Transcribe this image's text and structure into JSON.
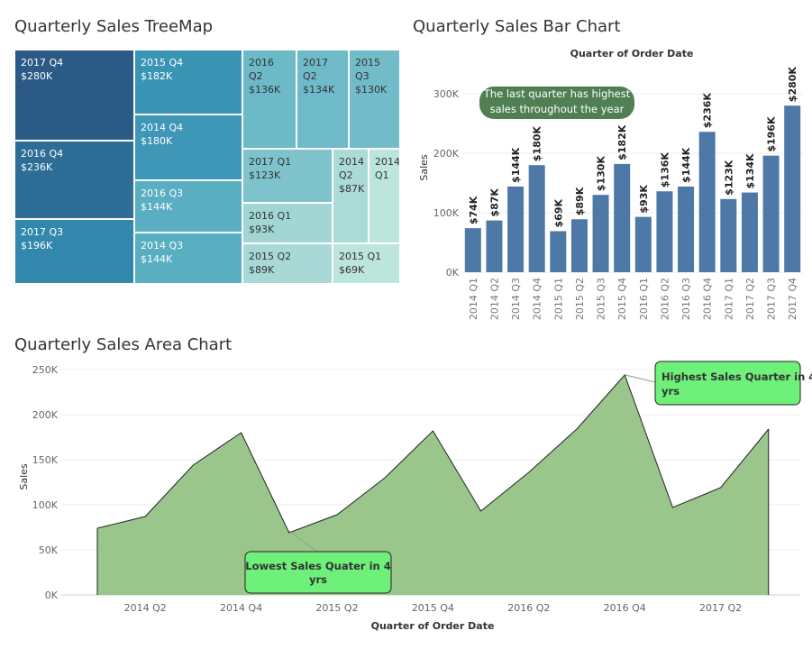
{
  "titles": {
    "treemap": "Quarterly Sales TreeMap",
    "bar": "Quarterly Sales Bar Chart",
    "area": "Quarterly Sales Area Chart"
  },
  "treemap_cells": [
    {
      "label": "2017 Q4",
      "value_label": "$280K",
      "color": "#2b5a87"
    },
    {
      "label": "2016 Q4",
      "value_label": "$236K",
      "color": "#2e6d95"
    },
    {
      "label": "2017 Q3",
      "value_label": "$196K",
      "color": "#3188ac"
    },
    {
      "label": "2015 Q4",
      "value_label": "$182K",
      "color": "#3a95b5"
    },
    {
      "label": "2014 Q4",
      "value_label": "$180K",
      "color": "#3e97b6"
    },
    {
      "label": "2016 Q3",
      "value_label": "$144K",
      "color": "#5aaec2"
    },
    {
      "label": "2014 Q3",
      "value_label": "$144K",
      "color": "#5aaec2"
    },
    {
      "label": "2016 Q2",
      "value_label": "$136K",
      "color": "#6cb9c7"
    },
    {
      "label": "2017 Q2",
      "value_label": "$134K",
      "color": "#6fbac8"
    },
    {
      "label": "2015 Q3",
      "value_label": "$130K",
      "color": "#72bcc9"
    },
    {
      "label": "2017 Q1",
      "value_label": "$123K",
      "color": "#7ec3cc"
    },
    {
      "label": "2016 Q1",
      "value_label": "$93K",
      "color": "#a2d6d4"
    },
    {
      "label": "2015 Q2",
      "value_label": "$89K",
      "color": "#a8d9d6"
    },
    {
      "label": "2014 Q2",
      "value_label": "$87K",
      "color": "#abdbd7"
    },
    {
      "label": "2015 Q1",
      "value_label": "$69K",
      "color": "#bce5dc"
    },
    {
      "label": "2014 Q1",
      "value_label": "",
      "color": "#bce5dc"
    }
  ],
  "bar_chart": {
    "header": "Quarter of Order Date",
    "ylabel": "Sales",
    "y_ticks": [
      "0K",
      "100K",
      "200K",
      "300K"
    ],
    "annotation": [
      "The last quarter has highest",
      "sales throughout the year"
    ]
  },
  "area_chart": {
    "xlabel": "Quarter of Order Date",
    "ylabel": "Sales",
    "y_ticks": [
      "0K",
      "50K",
      "100K",
      "150K",
      "200K",
      "250K"
    ],
    "x_ticks": [
      "2014 Q2",
      "2014 Q4",
      "2015 Q2",
      "2015 Q4",
      "2016 Q2",
      "2016 Q4",
      "2017 Q2"
    ],
    "annotation_low": [
      "Lowest Sales Quater in 4",
      "yrs"
    ],
    "annotation_high": [
      "Highest Sales Quarter in 4",
      "yrs"
    ]
  },
  "colors": {
    "bar": "#4e79a7",
    "area_fill": "#9ac68b",
    "area_line": "#222222",
    "callout_bar": "#4f7f52",
    "callout_area": "#6ef07a"
  },
  "chart_data": [
    {
      "type": "bar",
      "title": "Quarterly Sales Bar Chart",
      "xlabel": "Quarter of Order Date",
      "ylabel": "Sales",
      "categories": [
        "2014 Q1",
        "2014 Q2",
        "2014 Q3",
        "2014 Q4",
        "2015 Q1",
        "2015 Q2",
        "2015 Q3",
        "2015 Q4",
        "2016 Q1",
        "2016 Q2",
        "2016 Q3",
        "2016 Q4",
        "2017 Q1",
        "2017 Q2",
        "2017 Q3",
        "2017 Q4"
      ],
      "values": [
        74000,
        87000,
        144000,
        180000,
        69000,
        89000,
        130000,
        182000,
        93000,
        136000,
        144000,
        236000,
        123000,
        134000,
        196000,
        280000
      ],
      "data_labels": [
        "$74K",
        "$87K",
        "$144K",
        "$180K",
        "$69K",
        "$89K",
        "$130K",
        "$182K",
        "$93K",
        "$136K",
        "$144K",
        "$236K",
        "$123K",
        "$134K",
        "$196K",
        "$280K"
      ],
      "ylim": [
        0,
        300000
      ],
      "grid": true
    },
    {
      "type": "area",
      "title": "Quarterly Sales Area Chart",
      "xlabel": "Quarter of Order Date",
      "ylabel": "Sales",
      "categories": [
        "2014 Q1",
        "2014 Q2",
        "2014 Q3",
        "2014 Q4",
        "2015 Q1",
        "2015 Q2",
        "2015 Q3",
        "2015 Q4",
        "2016 Q1",
        "2016 Q2",
        "2016 Q3",
        "2016 Q4",
        "2017 Q1",
        "2017 Q2",
        "2017 Q3"
      ],
      "values": [
        74000,
        87000,
        144000,
        180000,
        69000,
        89000,
        130000,
        182000,
        93000,
        136000,
        184000,
        244000,
        97000,
        119000,
        184000
      ],
      "ylim": [
        0,
        250000
      ],
      "grid": true
    },
    {
      "type": "treemap",
      "title": "Quarterly Sales TreeMap",
      "categories": [
        "2017 Q4",
        "2016 Q4",
        "2017 Q3",
        "2015 Q4",
        "2014 Q4",
        "2016 Q3",
        "2014 Q3",
        "2016 Q2",
        "2017 Q2",
        "2015 Q3",
        "2017 Q1",
        "2016 Q1",
        "2015 Q2",
        "2014 Q2",
        "2015 Q1",
        "2014 Q1"
      ],
      "values": [
        280000,
        236000,
        196000,
        182000,
        180000,
        144000,
        144000,
        136000,
        134000,
        130000,
        123000,
        93000,
        89000,
        87000,
        69000,
        74000
      ]
    }
  ]
}
